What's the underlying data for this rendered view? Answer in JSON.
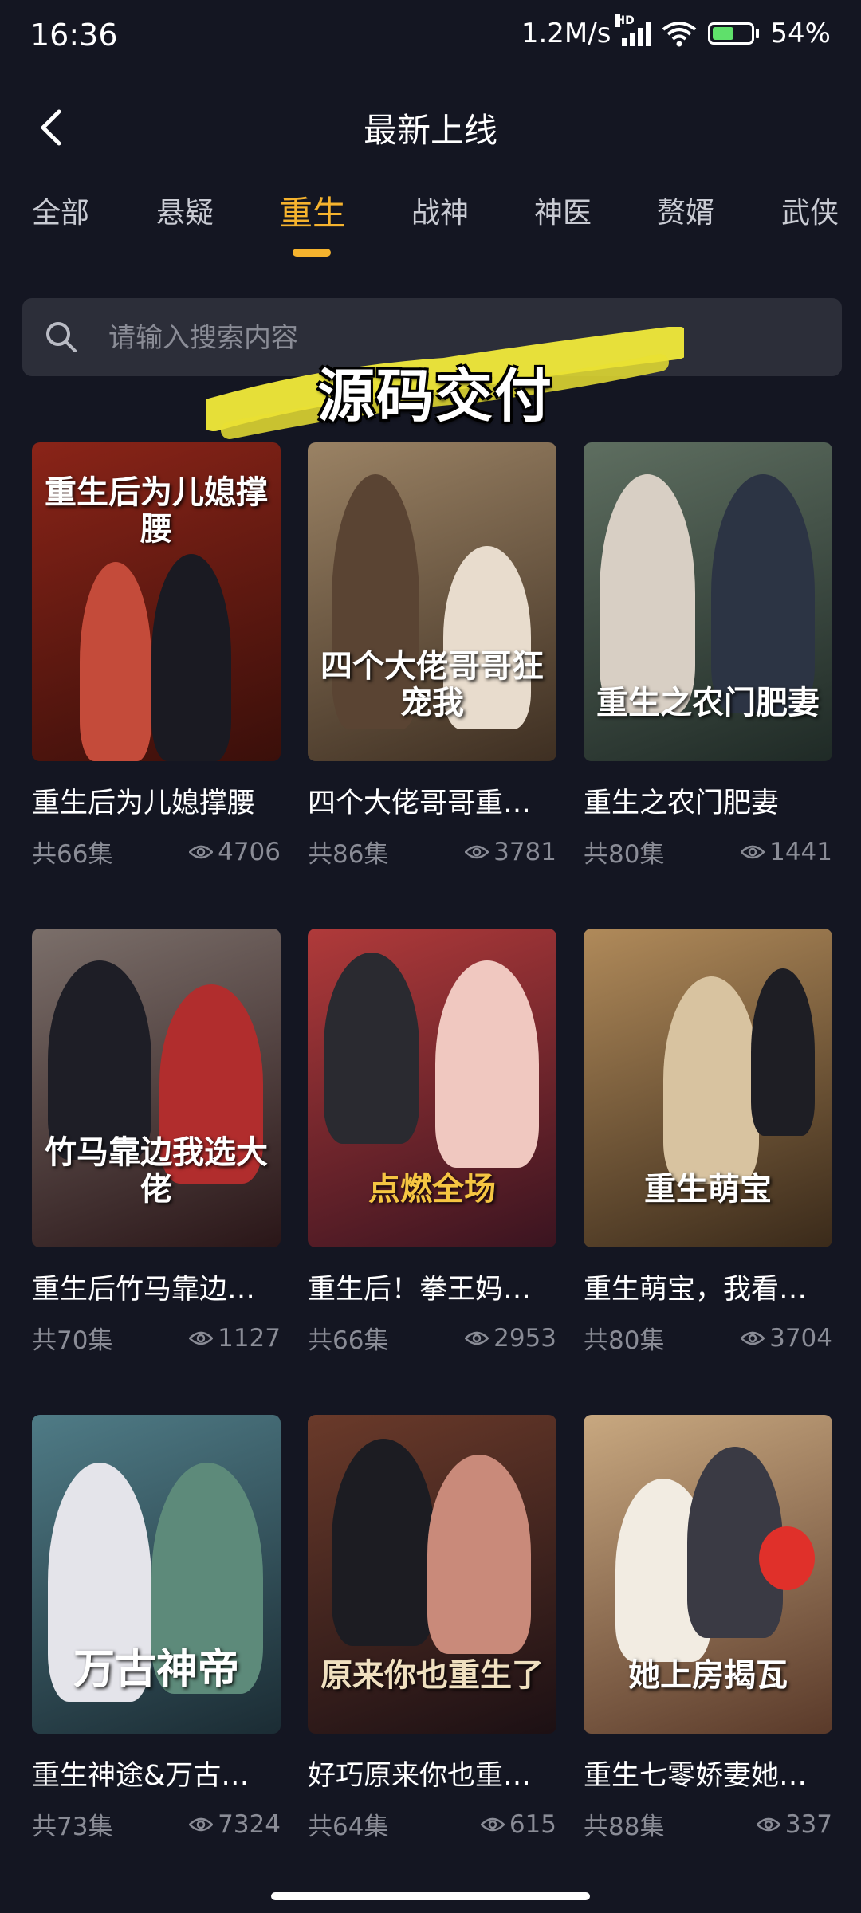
{
  "status": {
    "time": "16:36",
    "network_speed": "1.2M/s",
    "signal_badge": "HD",
    "battery": "54%"
  },
  "header": {
    "title": "最新上线"
  },
  "tabs": [
    {
      "label": "全部",
      "active": false
    },
    {
      "label": "悬疑",
      "active": false
    },
    {
      "label": "重生",
      "active": true
    },
    {
      "label": "战神",
      "active": false
    },
    {
      "label": "神医",
      "active": false
    },
    {
      "label": "赘婿",
      "active": false
    },
    {
      "label": "武侠",
      "active": false
    }
  ],
  "search": {
    "placeholder": "请输入搜索内容"
  },
  "watermark": {
    "text": "源码交付"
  },
  "dramas": [
    {
      "title": "重生后为儿媳撑腰",
      "episodes": "共66集",
      "views": "4706",
      "poster_text": "重生后为儿媳撑腰",
      "colors": [
        "#8a2418",
        "#3a0f0a"
      ]
    },
    {
      "title": "四个大佬哥哥重…",
      "episodes": "共86集",
      "views": "3781",
      "poster_text": "四个大佬哥哥狂宠我",
      "colors": [
        "#9a8264",
        "#3e2f22"
      ]
    },
    {
      "title": "重生之农门肥妻",
      "episodes": "共80集",
      "views": "1441",
      "poster_text": "重生之农门肥妻",
      "colors": [
        "#5e6e60",
        "#1f2a26"
      ]
    },
    {
      "title": "重生后竹马靠边…",
      "episodes": "共70集",
      "views": "1127",
      "poster_text": "竹马靠边我选大佬",
      "colors": [
        "#7b6f6a",
        "#2a1618"
      ]
    },
    {
      "title": "重生后！拳王妈…",
      "episodes": "共66集",
      "views": "2953",
      "poster_text": "点燃全场",
      "colors": [
        "#b03a3a",
        "#3a1420"
      ]
    },
    {
      "title": "重生萌宝，我看…",
      "episodes": "共80集",
      "views": "3704",
      "poster_text": "重生萌宝",
      "colors": [
        "#b08a5a",
        "#3a2a1a"
      ]
    },
    {
      "title": "重生神途&万古…",
      "episodes": "共73集",
      "views": "7324",
      "poster_text": "万古神帝",
      "colors": [
        "#4f7b86",
        "#1b2c34"
      ]
    },
    {
      "title": "好巧原来你也重…",
      "episodes": "共64集",
      "views": "615",
      "poster_text": "原来你也重生了",
      "colors": [
        "#6a3a2a",
        "#1c1014"
      ]
    },
    {
      "title": "重生七零娇妻她…",
      "episodes": "共88集",
      "views": "337",
      "poster_text": "她上房揭瓦",
      "colors": [
        "#c8a880",
        "#5a3a2a"
      ]
    }
  ]
}
